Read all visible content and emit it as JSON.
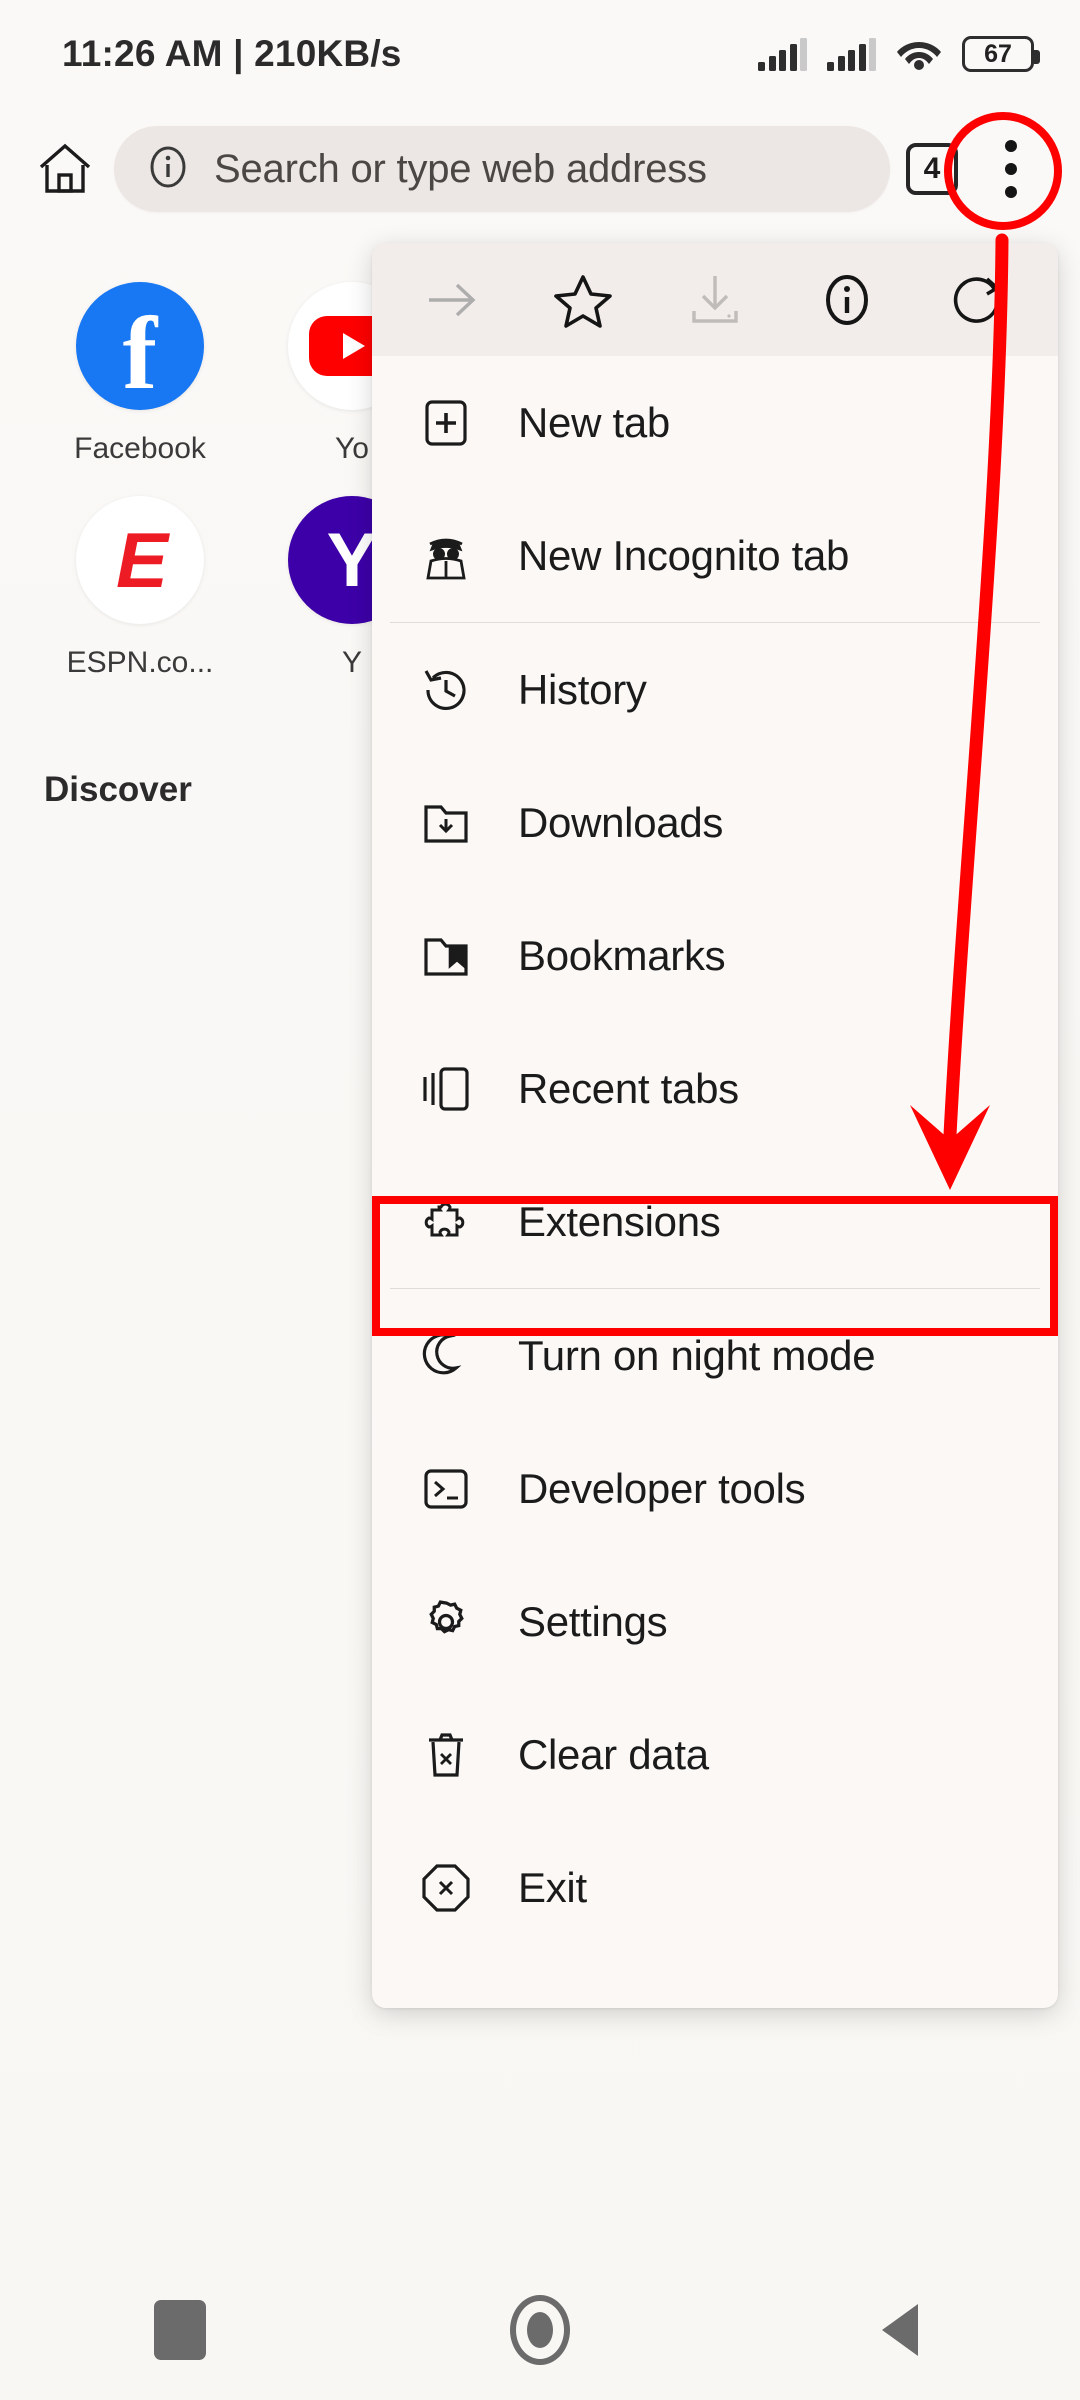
{
  "status_bar": {
    "time_and_speed": "11:26 AM | 210KB/s",
    "battery_level": "67",
    "icons": [
      "signal-bars-sim1-icon",
      "signal-bars-sim2-icon",
      "wifi-icon",
      "battery-icon"
    ]
  },
  "toolbar": {
    "home_icon": "home-icon",
    "security_icon": "info-circle-icon",
    "url_placeholder": "Search or type web address",
    "tab_count": "4",
    "overflow_icon": "three-dot-menu-icon"
  },
  "shortcuts": [
    {
      "label": "Facebook",
      "icon": "facebook-icon"
    },
    {
      "label": "Yo",
      "icon": "youtube-icon"
    },
    {
      "label": "ESPN.co...",
      "icon": "espn-icon"
    },
    {
      "label": "Y",
      "icon": "yahoo-icon"
    }
  ],
  "feed": {
    "section_title": "Discover"
  },
  "menu": {
    "quick_actions": [
      {
        "name": "forward",
        "icon": "arrow-right-icon",
        "enabled": "false"
      },
      {
        "name": "bookmark",
        "icon": "star-outline-icon",
        "enabled": "true"
      },
      {
        "name": "download",
        "icon": "download-icon",
        "enabled": "false"
      },
      {
        "name": "page-info",
        "icon": "info-circle-icon",
        "enabled": "true"
      },
      {
        "name": "reload",
        "icon": "reload-icon",
        "enabled": "true"
      }
    ],
    "groups": [
      {
        "items": [
          {
            "label": "New tab",
            "icon": "new-tab-icon"
          },
          {
            "label": "New Incognito tab",
            "icon": "incognito-icon"
          }
        ]
      },
      {
        "items": [
          {
            "label": "History",
            "icon": "history-clock-icon"
          },
          {
            "label": "Downloads",
            "icon": "downloads-folder-icon"
          },
          {
            "label": "Bookmarks",
            "icon": "bookmarks-folder-icon"
          },
          {
            "label": "Recent tabs",
            "icon": "recent-tabs-icon"
          },
          {
            "label": "Extensions",
            "icon": "puzzle-piece-icon"
          }
        ]
      },
      {
        "items": [
          {
            "label": "Turn on night mode",
            "icon": "moon-icon"
          },
          {
            "label": "Developer tools",
            "icon": "terminal-icon"
          },
          {
            "label": "Settings",
            "icon": "gear-icon"
          },
          {
            "label": "Clear data",
            "icon": "trash-x-icon"
          },
          {
            "label": "Exit",
            "icon": "exit-octagon-x-icon"
          }
        ]
      }
    ]
  },
  "annotations": {
    "color": "#FF0000",
    "circle_target": "three-dot-menu-icon",
    "arrow_target": "Extensions",
    "rectangle_target": "Extensions"
  },
  "navigation_bar": {
    "recents": "recents-square-icon",
    "home": "home-circle-icon",
    "back": "back-triangle-icon"
  }
}
